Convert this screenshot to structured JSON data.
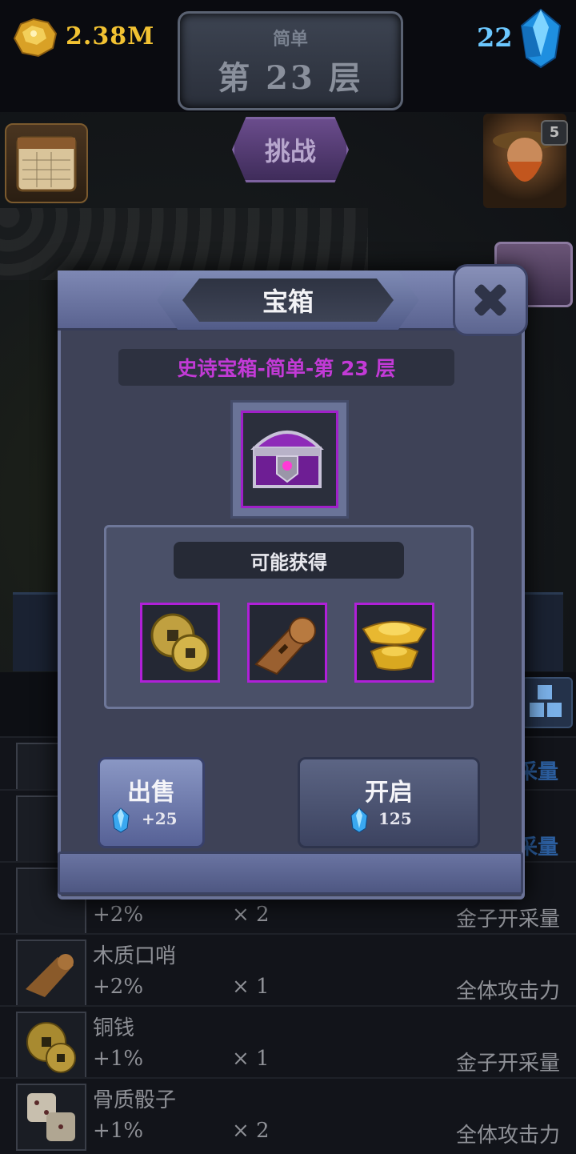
{
  "top_bar": {
    "gold": "2.38M",
    "gems": "22",
    "difficulty": "简单",
    "floor": "第 23 层",
    "gold_icon": "gold-nugget-icon",
    "gem_icon": "blue-crystal-icon"
  },
  "scene": {
    "challenge_label": "挑战",
    "hero_level": "5",
    "calendar_icon": "daily-calendar-icon"
  },
  "modal": {
    "title": "宝箱",
    "chest_name": "史诗宝箱-简单-第 23 层",
    "chest_icon": "epic-chest-icon",
    "rewards_title": "可能获得",
    "rewards": [
      {
        "icon": "copper-coins-icon"
      },
      {
        "icon": "wooden-whistle-icon"
      },
      {
        "icon": "gold-ingot-icon"
      }
    ],
    "sell": {
      "label": "出售",
      "price": "+25"
    },
    "open": {
      "label": "开启",
      "price": "125"
    }
  },
  "background_list": {
    "right_labels": [
      "采量",
      "采量"
    ],
    "rows": [
      {
        "name": "",
        "pct": "+2%",
        "count": "× 2",
        "effect": "金子开采量"
      },
      {
        "name": "木质口哨",
        "pct": "+2%",
        "count": "× 1",
        "effect": "全体攻击力"
      },
      {
        "name": "铜钱",
        "pct": "+1%",
        "count": "× 1",
        "effect": "金子开采量"
      },
      {
        "name": "骨质骰子",
        "pct": "+1%",
        "count": "× 2",
        "effect": "全体攻击力"
      }
    ]
  },
  "colors": {
    "accent_purple": "#c23ad6",
    "gold_text": "#f2c232",
    "gem_text": "#6cc8ff"
  }
}
